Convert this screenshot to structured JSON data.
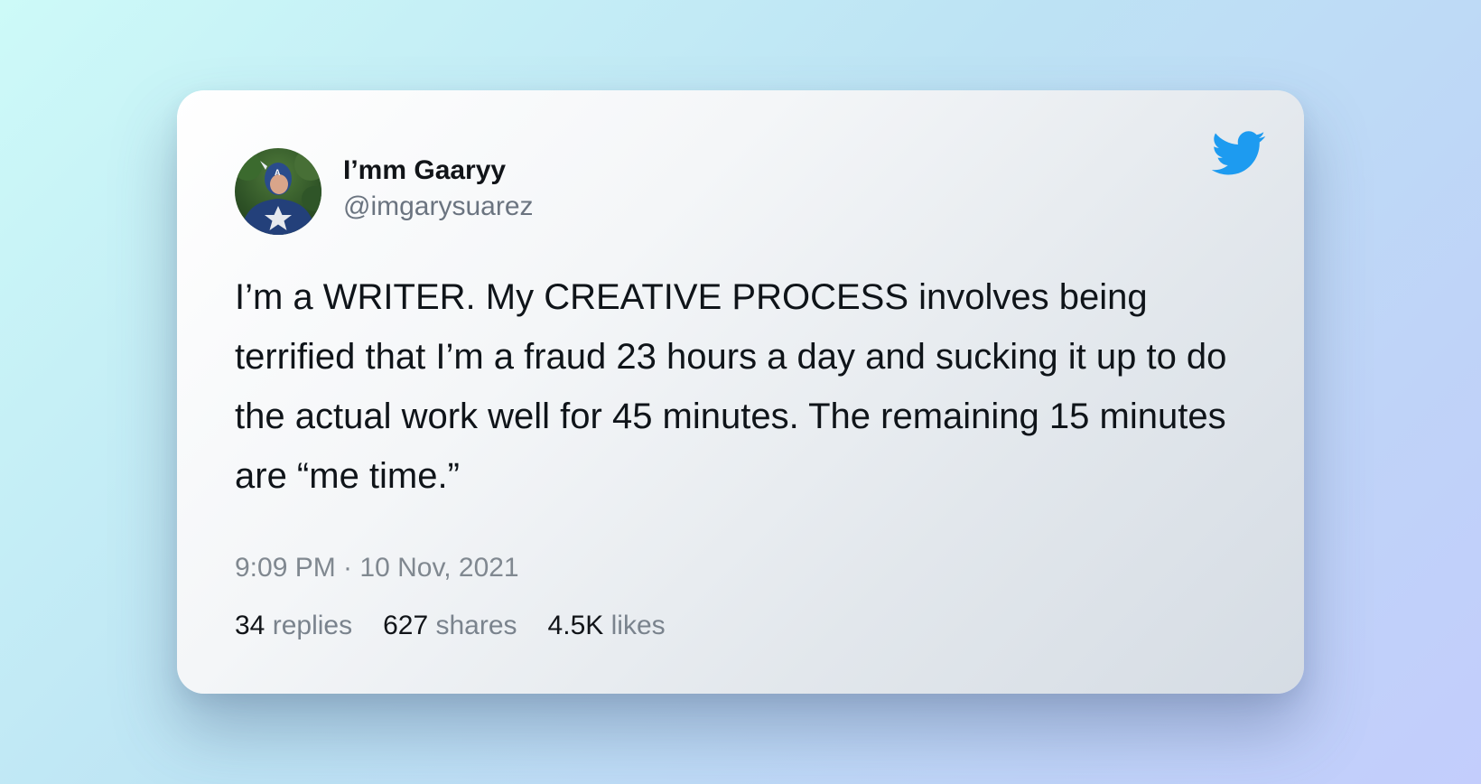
{
  "tweet": {
    "author": {
      "name": "I’mm Gaaryy",
      "handle": "@imgarysuarez",
      "avatar_icon": "captain-america-avatar"
    },
    "platform_icon": "twitter-bird-icon",
    "brand_color": "#1d9bf0",
    "text": "I’m a WRITER. My CREATIVE PROCESS involves being terrified that I’m a fraud 23 hours a day and sucking it up to do the actual work well for 45 minutes. The remaining 15 minutes are “me time.”",
    "timestamp": "9:09 PM · 10 Nov, 2021",
    "stats": {
      "replies": {
        "count": "34",
        "label": "replies"
      },
      "shares": {
        "count": "627",
        "label": "shares"
      },
      "likes": {
        "count": "4.5K",
        "label": "likes"
      }
    }
  }
}
